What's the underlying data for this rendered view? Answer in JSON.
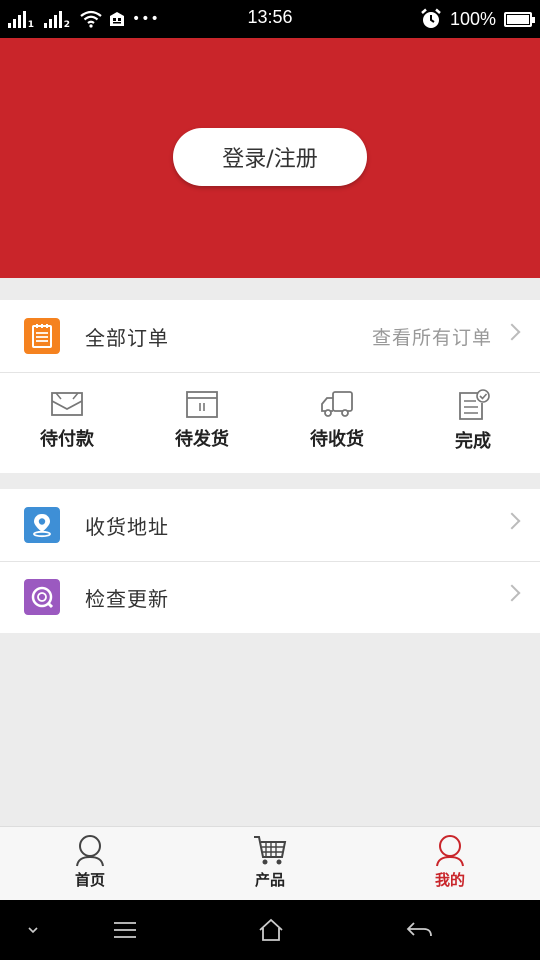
{
  "status_bar": {
    "time": "13:56",
    "battery": "100%",
    "battery_level": 1.0,
    "sim1_label": "1",
    "sim2_label": "2",
    "more_dots": "•••",
    "icons": [
      "signal-icon",
      "signal-icon",
      "wifi-icon",
      "store-icon",
      "alarm-icon",
      "battery-icon"
    ]
  },
  "header": {
    "login_label": "登录/注册",
    "background": "#c9252a"
  },
  "orders": {
    "title": "全部订单",
    "view_all": "查看所有订单",
    "icon": "notepad-icon",
    "icon_color": "#f5821f",
    "statuses": [
      {
        "label": "待付款",
        "icon": "envelope-icon"
      },
      {
        "label": "待发货",
        "icon": "box-icon"
      },
      {
        "label": "待收货",
        "icon": "truck-icon"
      },
      {
        "label": "完成",
        "icon": "checklist-icon"
      }
    ]
  },
  "menu": [
    {
      "label": "收货地址",
      "icon": "location-icon",
      "icon_color": "#3e8fd6"
    },
    {
      "label": "检查更新",
      "icon": "refresh-search-icon",
      "icon_color": "#9b59c0"
    }
  ],
  "tabbar": {
    "tabs": [
      {
        "label": "首页",
        "icon": "person-icon",
        "active": false
      },
      {
        "label": "产品",
        "icon": "cart-icon",
        "active": false
      },
      {
        "label": "我的",
        "icon": "person-icon",
        "active": true
      }
    ],
    "active_color": "#c9252a"
  },
  "navbar": {
    "icons": [
      "chevron-down-icon",
      "menu-icon",
      "home-icon",
      "back-icon"
    ]
  }
}
